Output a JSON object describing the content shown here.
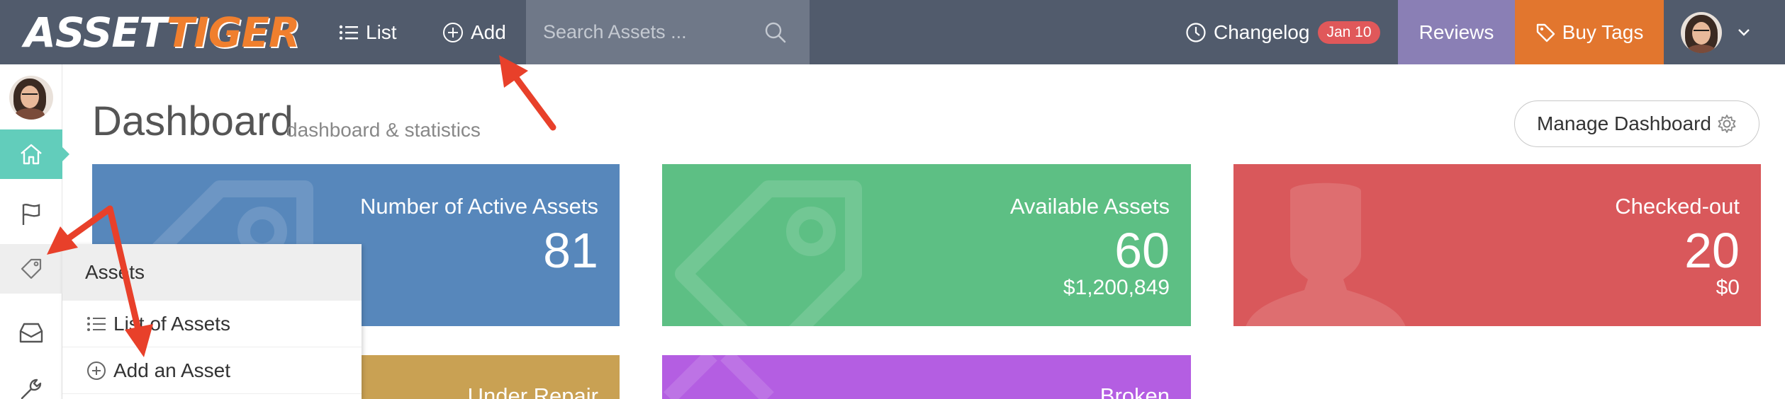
{
  "brand": {
    "logo_part1": "ASSET",
    "logo_part2": "TIGER"
  },
  "topnav": {
    "list_label": "List",
    "add_label": "Add",
    "search_placeholder": "Search Assets ...",
    "changelog_label": "Changelog",
    "changelog_badge": "Jan 10",
    "reviews_label": "Reviews",
    "buy_tags_label": "Buy Tags"
  },
  "page": {
    "title": "Dashboard",
    "subtitle": "dashboard & statistics",
    "manage_button": "Manage Dashboard"
  },
  "sidebar": {
    "items": [
      {
        "icon": "home-icon",
        "active": true
      },
      {
        "icon": "flag-icon"
      },
      {
        "icon": "tag-icon",
        "hover": true
      },
      {
        "icon": "inbox-icon"
      },
      {
        "icon": "wrench-icon"
      }
    ],
    "flyout": {
      "title": "Assets",
      "items": [
        "List of Assets",
        "Add an Asset"
      ]
    }
  },
  "tiles": [
    {
      "label": "Number of Active Assets",
      "value": "81",
      "sub": "",
      "color": "#5787bb"
    },
    {
      "label": "Available Assets",
      "value": "60",
      "sub": "$1,200,849",
      "color": "#5dbf84"
    },
    {
      "label": "Checked-out",
      "value": "20",
      "sub": "$0",
      "color": "#d9585b"
    },
    {
      "label": "Under Repair",
      "value": "",
      "sub": "",
      "color": "#c9a153"
    },
    {
      "label": "Broken",
      "value": "",
      "sub": "",
      "color": "#b45ee2"
    }
  ],
  "colors": {
    "topbar": "#515b6c",
    "accent_teal": "#62cdbb",
    "reviews": "#8a7fb5",
    "buy_tags": "#e2762e",
    "annotation_arrow": "#e8402a"
  }
}
